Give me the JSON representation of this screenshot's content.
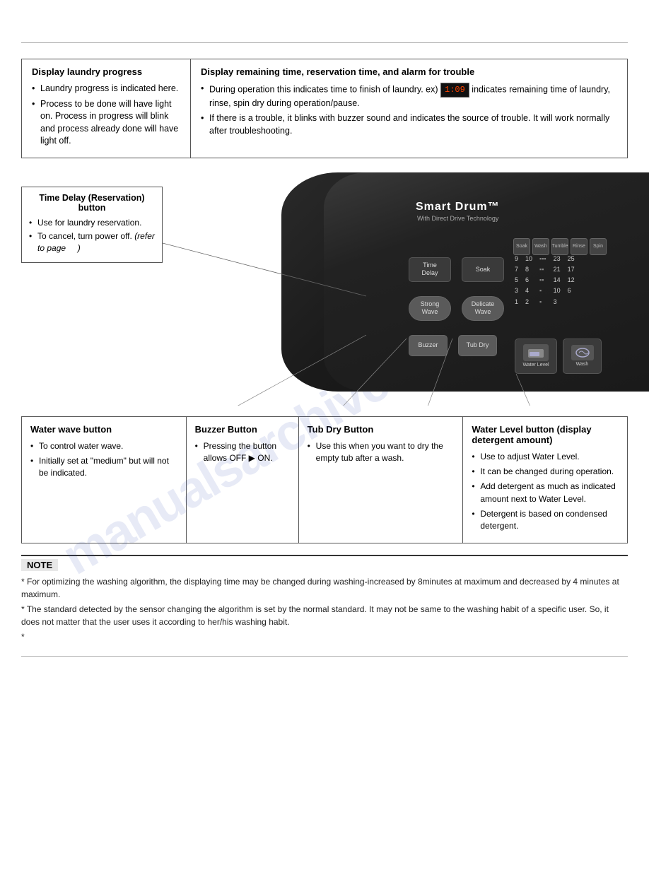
{
  "page": {
    "top_rule": true,
    "watermark": "manualsarchive.com"
  },
  "display_progress": {
    "title": "Display laundry progress",
    "bullets": [
      "Laundry progress is indicated here.",
      "Process to be done will have light on. Process in progress will blink and process already done will have light off."
    ]
  },
  "display_remaining": {
    "title": "Display remaining time, reservation time, and alarm for trouble",
    "bullets": [
      "During operation this indicates time to finish of laundry. ex)  indicates remaining time of laundry, rinse, spin dry during operation/pause.",
      "If there is a trouble, it blinks with buzzer sound and  indicates the source of  trouble. It will work normally after troubleshooting."
    ]
  },
  "time_delay_callout": {
    "title": "Time Delay (Reservation) button",
    "bullets": [
      "Use for laundry reservation.",
      "To cancel, turn power off. (refer to page    )"
    ]
  },
  "machine": {
    "brand": "Smart Drum™",
    "brand_sub": "With Direct Drive Technology",
    "buttons": {
      "time_delay": "Time\nDelay",
      "soak": "Soak",
      "strong_wave": "Strong\nWave",
      "delicate_wave": "Delicate\nWave",
      "buzzer": "Buzzer",
      "tub_dry": "Tub Dry",
      "water_level": "Water Level",
      "wash": "Wash"
    },
    "cycle_labels": [
      "Soak",
      "Wash",
      "Tumble",
      "Rinse",
      "Spin"
    ],
    "numbers_left": [
      "9",
      "7",
      "5",
      "3",
      "1"
    ],
    "numbers_right_col1": [
      "10",
      "8",
      "6",
      "4",
      "2"
    ],
    "numbers_right_col2": [
      "23",
      "21",
      "14",
      "10",
      "3"
    ],
    "numbers_right_col3": [
      "25",
      "17",
      "12",
      "6",
      ""
    ]
  },
  "bottom_boxes": {
    "water_wave": {
      "title": "Water wave button",
      "bullets": [
        "To control water wave.",
        "Initially set at \"medium\" but will not be indicated."
      ]
    },
    "buzzer": {
      "title": "Buzzer Button",
      "bullets": [
        "Pressing the button allows OFF ▶ ON."
      ]
    },
    "tub_dry": {
      "title": "Tub Dry Button",
      "bullets": [
        "Use this when you want to dry the empty tub after a wash."
      ]
    },
    "water_level": {
      "title": "Water Level button (display detergent amount)",
      "bullets": [
        "Use to adjust Water Level.",
        "It can be changed during operation.",
        "Add detergent as much as indicated amount next to Water Level.",
        "Detergent is based on condensed detergent."
      ]
    }
  },
  "note": {
    "label": "NOTE",
    "lines": [
      "* For optimizing the washing algorithm, the displaying time may be changed during washing-increased by 8minutes at maximum and decreased by 4 minutes at maximum.",
      "* The standard detected by the sensor changing the algorithm is set by the normal standard. It may not be same to  the washing habit of a specific user. So, it does not matter that the user uses it according to her/his washing habit.",
      "*"
    ]
  }
}
